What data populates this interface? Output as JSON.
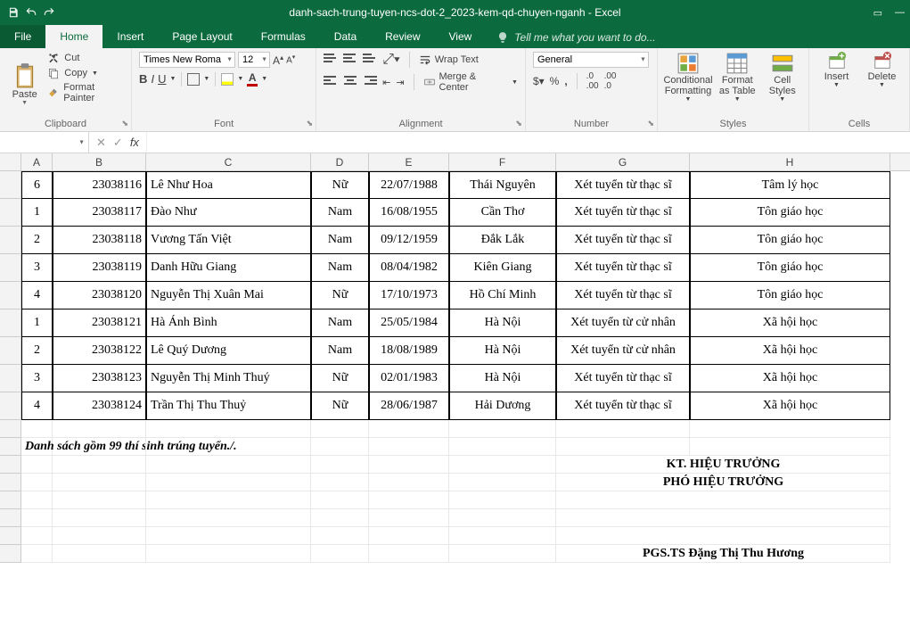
{
  "title": "danh-sach-trung-tuyen-ncs-dot-2_2023-kem-qd-chuyen-nganh - Excel",
  "tabs": [
    "File",
    "Home",
    "Insert",
    "Page Layout",
    "Formulas",
    "Data",
    "Review",
    "View"
  ],
  "tell_me": "Tell me what you want to do...",
  "clipboard": {
    "paste": "Paste",
    "cut": "Cut",
    "copy": "Copy",
    "painter": "Format Painter",
    "label": "Clipboard"
  },
  "font": {
    "name": "Times New Roma",
    "size": "12",
    "label": "Font"
  },
  "alignment": {
    "wrap": "Wrap Text",
    "merge": "Merge & Center",
    "label": "Alignment"
  },
  "number": {
    "format": "General",
    "label": "Number"
  },
  "styles": {
    "cond": "Conditional Formatting",
    "table": "Format as Table",
    "cell": "Cell Styles",
    "label": "Styles"
  },
  "cells": {
    "insert": "Insert",
    "delete": "Delete",
    "label": "Cells"
  },
  "fx_label": "fx",
  "columns": [
    "A",
    "B",
    "C",
    "D",
    "E",
    "F",
    "G",
    "H"
  ],
  "rows": [
    {
      "a": "6",
      "b": "23038116",
      "c": "Lê Như Hoa",
      "d": "Nữ",
      "e": "22/07/1988",
      "f": "Thái Nguyên",
      "g": "Xét tuyển từ thạc sĩ",
      "h": "Tâm lý học"
    },
    {
      "a": "1",
      "b": "23038117",
      "c": "Đào Như",
      "d": "Nam",
      "e": "16/08/1955",
      "f": "Cần Thơ",
      "g": "Xét tuyển từ thạc sĩ",
      "h": "Tôn giáo học"
    },
    {
      "a": "2",
      "b": "23038118",
      "c": "Vương Tấn Việt",
      "d": "Nam",
      "e": "09/12/1959",
      "f": "Đắk Lắk",
      "g": "Xét tuyển từ thạc sĩ",
      "h": "Tôn giáo học"
    },
    {
      "a": "3",
      "b": "23038119",
      "c": "Danh Hữu Giang",
      "d": "Nam",
      "e": "08/04/1982",
      "f": "Kiên Giang",
      "g": "Xét tuyển từ thạc sĩ",
      "h": "Tôn giáo học"
    },
    {
      "a": "4",
      "b": "23038120",
      "c": "Nguyễn Thị Xuân Mai",
      "d": "Nữ",
      "e": "17/10/1973",
      "f": "Hồ Chí Minh",
      "g": "Xét tuyển từ thạc sĩ",
      "h": "Tôn giáo học"
    },
    {
      "a": "1",
      "b": "23038121",
      "c": "Hà Ánh Bình",
      "d": "Nam",
      "e": "25/05/1984",
      "f": "Hà Nội",
      "g": "Xét tuyển từ cử nhân",
      "h": "Xã hội học"
    },
    {
      "a": "2",
      "b": "23038122",
      "c": "Lê Quý Dương",
      "d": "Nam",
      "e": "18/08/1989",
      "f": "Hà Nội",
      "g": "Xét tuyển từ cử nhân",
      "h": "Xã hội học"
    },
    {
      "a": "3",
      "b": "23038123",
      "c": "Nguyễn Thị Minh Thuý",
      "d": "Nữ",
      "e": "02/01/1983",
      "f": "Hà Nội",
      "g": "Xét tuyển từ thạc sĩ",
      "h": "Xã hội học"
    },
    {
      "a": "4",
      "b": "23038124",
      "c": "Trần Thị Thu Thuỷ",
      "d": "Nữ",
      "e": "28/06/1987",
      "f": "Hải Dương",
      "g": "Xét tuyển từ thạc sĩ",
      "h": "Xã hội học"
    }
  ],
  "footer_note": "Danh sách gồm 99 thí sinh trúng tuyển./.",
  "sig1": "KT. HIỆU TRƯỞNG",
  "sig2": "PHÓ HIỆU TRƯỞNG",
  "sig3": "PGS.TS Đặng Thị Thu Hương"
}
